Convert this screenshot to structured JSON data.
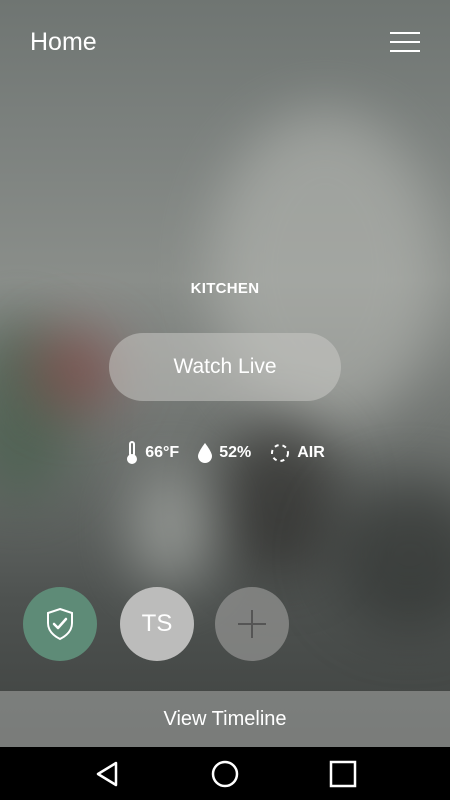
{
  "header": {
    "title": "Home",
    "menu_icon": "hamburger-menu-icon"
  },
  "room": {
    "name": "KITCHEN"
  },
  "watch_live": {
    "label": "Watch Live"
  },
  "stats": {
    "temperature": "66°F",
    "humidity": "52%",
    "air": "AIR"
  },
  "actions": {
    "security_icon": "shield-check-icon",
    "user_initials": "TS",
    "add_icon": "plus-icon"
  },
  "footer": {
    "timeline_label": "View Timeline"
  },
  "android_nav": {
    "back_icon": "back-triangle-icon",
    "home_icon": "home-circle-icon",
    "recents_icon": "recents-square-icon"
  },
  "colors": {
    "security_green": "#5e8b77",
    "avatar_gray": "#bcbcbb"
  }
}
